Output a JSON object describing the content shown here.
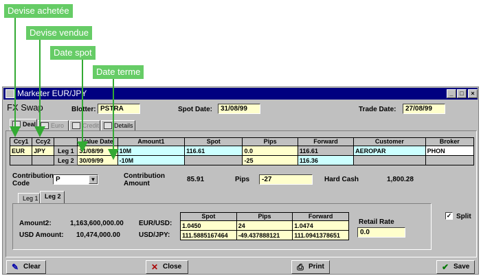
{
  "callouts": {
    "ccy1": "Devise achetée",
    "ccy2": "Devise vendue",
    "spot": "Date spot",
    "terme": "Date terme"
  },
  "window": {
    "title": "Marketer   EUR/JPY",
    "minimize": "_",
    "maximize": "□",
    "close": "×"
  },
  "header": {
    "deal_type": "FX Swap",
    "blotter_label": "Blotter:",
    "blotter_value": "PSTRA",
    "spot_date_label": "Spot Date:",
    "spot_date_value": "31/08/99",
    "trade_date_label": "Trade Date:",
    "trade_date_value": "27/08/99"
  },
  "tabs": [
    {
      "label": "Deal"
    },
    {
      "label": "Euro"
    },
    {
      "label": "Credit"
    },
    {
      "label": "Details"
    }
  ],
  "deal_table": {
    "headers": [
      "Ccy1",
      "Ccy2",
      "",
      "Value Date",
      "Amount1",
      "Spot",
      "Pips",
      "Forward",
      "Customer",
      "Broker"
    ],
    "rows": [
      [
        "EUR",
        "JPY",
        "Leg 1",
        "31/08/99",
        "10M",
        "116.61",
        "0.0",
        "116.61",
        "AEROPAR",
        "PHON"
      ],
      [
        "",
        "",
        "Leg 2",
        "30/09/99",
        "-10M",
        "",
        "-25",
        "116.36",
        "",
        ""
      ]
    ]
  },
  "contribution": {
    "code_label": "Contribution\nCode",
    "code_value": "P",
    "amount_label": "Contribution\nAmount",
    "amount_value": "85.91",
    "pips_label": "Pips",
    "pips_value": "-27",
    "hard_cash_label": "Hard Cash",
    "hard_cash_value": "1,800.28"
  },
  "leg_tabs": [
    {
      "label": "Leg 1"
    },
    {
      "label": "Leg 2"
    }
  ],
  "leg_panel": {
    "amount2_label": "Amount2:",
    "amount2_value": "1,163,600,000.00",
    "usd_amount_label": "USD Amount:",
    "usd_amount_value": "10,474,000.00",
    "pair1_label": "EUR/USD:",
    "pair2_label": "USD/JPY:",
    "rate_headers": [
      "Spot",
      "Pips",
      "Forward"
    ],
    "rate_rows": [
      [
        "1.0450",
        "24",
        "1.0474"
      ],
      [
        "111.5885167464",
        "-49.437888121",
        "111.0941378651"
      ]
    ],
    "retail_rate_label": "Retail Rate",
    "retail_rate_value": "0.0"
  },
  "split": {
    "label": "Split",
    "checked": "✓"
  },
  "buttons": {
    "clear": "Clear",
    "close": "Close",
    "print": "Print",
    "save": "Save"
  }
}
